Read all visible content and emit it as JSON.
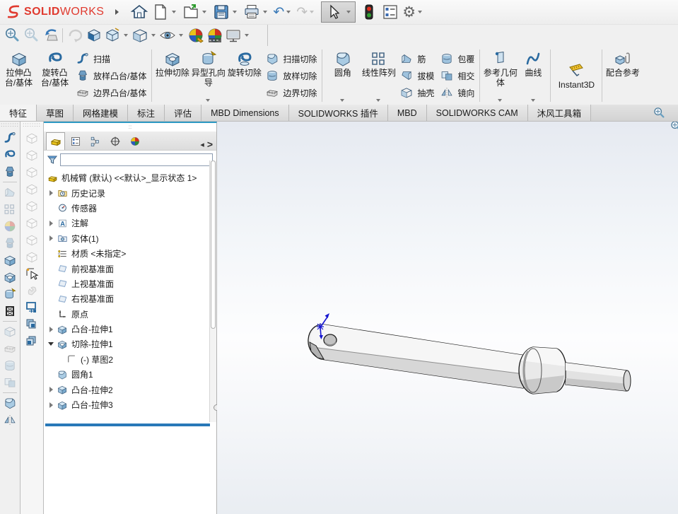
{
  "titlebar": {
    "logo_bold": "SOLID",
    "logo_light": "WORKS"
  },
  "tabs": {
    "active": "特征",
    "items": [
      {
        "label": "特征"
      },
      {
        "label": "草图"
      },
      {
        "label": "网格建模"
      },
      {
        "label": "标注"
      },
      {
        "label": "评估"
      },
      {
        "label": "MBD Dimensions"
      },
      {
        "label": "SOLIDWORKS 插件"
      },
      {
        "label": "MBD"
      },
      {
        "label": "SOLIDWORKS CAM"
      },
      {
        "label": "沐风工具箱"
      }
    ]
  },
  "ribbon": {
    "groups": [
      {
        "big": [
          "拉伸凸台/基体",
          "旋转凸台/基体"
        ],
        "small": [
          "扫描",
          "放样凸台/基体",
          "边界凸台/基体"
        ]
      },
      {
        "big": [
          "拉伸切除",
          "异型孔向导",
          "旋转切除"
        ],
        "small": [
          "扫描切除",
          "放样切除",
          "边界切除"
        ]
      },
      {
        "big": [
          "圆角",
          "线性阵列"
        ],
        "small": [
          "筋",
          "拔模",
          "抽壳"
        ],
        "small2": [
          "包覆",
          "相交",
          "镜向"
        ]
      },
      {
        "big": [
          "参考几何体",
          "曲线"
        ]
      },
      {
        "big": [
          "Instant3D"
        ]
      },
      {
        "big": [
          "配合参考"
        ]
      }
    ]
  },
  "feature_tree": {
    "filter_value": "",
    "root": "机械臂 (默认) <<默认>_显示状态 1>",
    "items": [
      {
        "label": "历史记录",
        "expander": "collapsed"
      },
      {
        "label": "传感器",
        "expander": "none"
      },
      {
        "label": "注解",
        "expander": "collapsed"
      },
      {
        "label": "实体(1)",
        "expander": "collapsed"
      },
      {
        "label": "材质 <未指定>",
        "expander": "none"
      },
      {
        "label": "前视基准面",
        "expander": "none"
      },
      {
        "label": "上视基准面",
        "expander": "none"
      },
      {
        "label": "右视基准面",
        "expander": "none"
      },
      {
        "label": "原点",
        "expander": "none"
      },
      {
        "label": "凸台-拉伸1",
        "expander": "collapsed"
      },
      {
        "label": "切除-拉伸1",
        "expander": "expanded"
      },
      {
        "label": "(-) 草图2",
        "expander": "none"
      },
      {
        "label": "圆角1",
        "expander": "none"
      },
      {
        "label": "凸台-拉伸2",
        "expander": "collapsed"
      },
      {
        "label": "凸台-拉伸3",
        "expander": "collapsed"
      }
    ]
  },
  "colors": {
    "brand_red": "#e03a2f",
    "accent_blue": "#2878b8",
    "panel_top_line": "#2e9ac4",
    "rollback_bar": "#2878b8"
  }
}
